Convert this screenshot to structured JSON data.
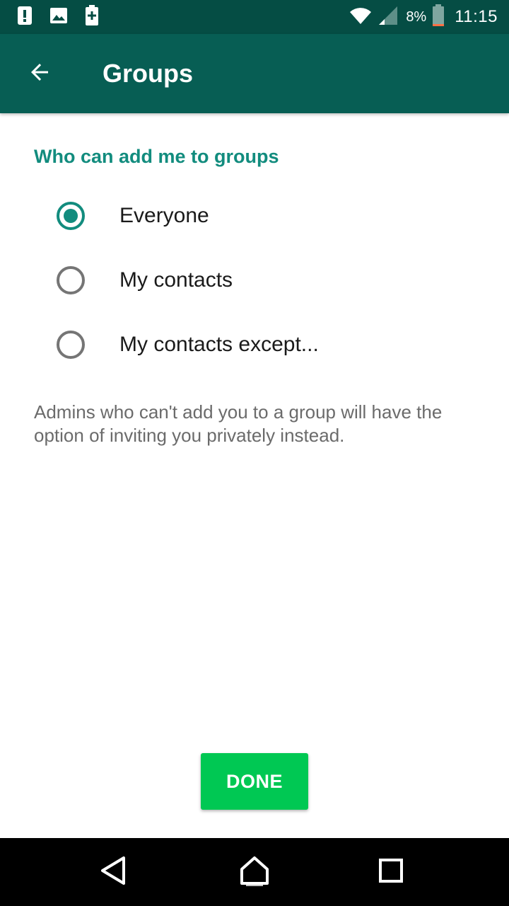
{
  "status_bar": {
    "icons_left": [
      "alert-icon",
      "image-icon",
      "battery-saver-icon"
    ],
    "icons_right": [
      "wifi-icon",
      "cell-signal-icon",
      "battery-icon"
    ],
    "battery_percent": "8%",
    "time": "11:15"
  },
  "app_bar": {
    "back_icon": "arrow-left-icon",
    "title": "Groups"
  },
  "section": {
    "title": "Who can add me to groups",
    "options": [
      {
        "label": "Everyone",
        "selected": true
      },
      {
        "label": "My contacts",
        "selected": false
      },
      {
        "label": "My contacts except...",
        "selected": false
      }
    ],
    "note": "Admins who can't add you to a group will have the option of inviting you privately instead."
  },
  "done_label": "DONE",
  "nav_bar": {
    "icons": [
      "back-triangle-icon",
      "home-icon",
      "recents-square-icon"
    ]
  },
  "colors": {
    "status_bar": "#054d44",
    "app_bar": "#075e54",
    "accent": "#128c7e",
    "done_button": "#00c853"
  }
}
